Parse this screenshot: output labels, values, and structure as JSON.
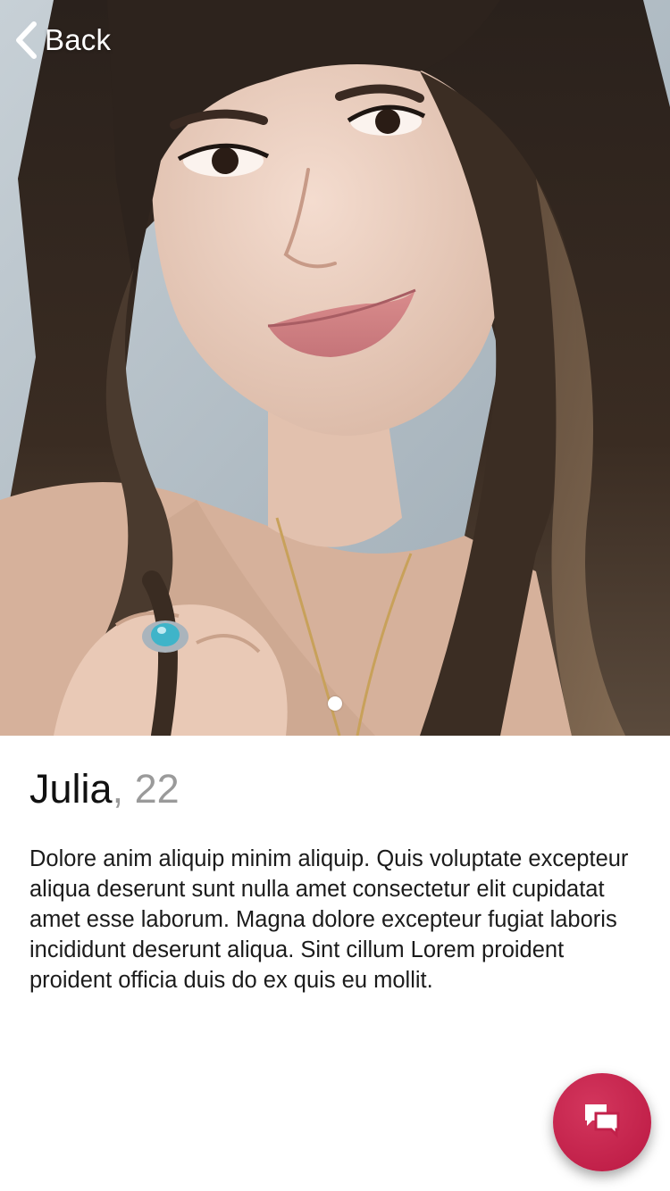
{
  "nav": {
    "back_label": "Back"
  },
  "photo": {
    "page_count": 1,
    "current_page": 1
  },
  "profile": {
    "name": "Julia",
    "age_separator": ", ",
    "age": "22",
    "bio": "Dolore anim aliquip minim aliquip. Quis voluptate excepteur aliqua deserunt sunt nulla amet consectetur elit cupidatat amet esse laborum. Magna dolore excepteur fugiat laboris incididunt deserunt aliqua. Sint cillum Lorem proident proident officia duis do ex quis eu mollit."
  },
  "fab": {
    "icon": "chat-bubbles-icon"
  },
  "colors": {
    "fab": "#c2214a",
    "name": "#111111",
    "age": "#9a9a9a",
    "text": "#1b1b1b"
  }
}
